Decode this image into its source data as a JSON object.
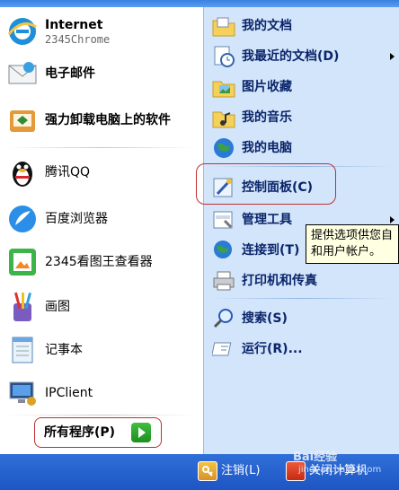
{
  "left": {
    "pinned": [
      {
        "title": "Internet",
        "subtitle": "2345Chrome",
        "icon": "internet-explorer-icon"
      },
      {
        "title": "电子邮件",
        "icon": "email-icon"
      },
      {
        "title": "强力卸载电脑上的软件",
        "icon": "uninstall-icon"
      }
    ],
    "recent": [
      {
        "title": "腾讯QQ",
        "icon": "qq-penguin-icon"
      },
      {
        "title": "百度浏览器",
        "icon": "baidu-browser-icon"
      },
      {
        "title": "2345看图王查看器",
        "icon": "image-viewer-icon"
      },
      {
        "title": "画图",
        "icon": "paint-icon"
      },
      {
        "title": "记事本",
        "icon": "notepad-icon"
      },
      {
        "title": "IPClient",
        "icon": "ipclient-icon"
      }
    ],
    "all_programs": "所有程序(P)"
  },
  "right": {
    "items": [
      {
        "label": "我的文档",
        "icon": "documents-folder-icon"
      },
      {
        "label": "我最近的文档(D)",
        "icon": "recent-documents-icon",
        "submenu": true
      },
      {
        "label": "图片收藏",
        "icon": "pictures-folder-icon"
      },
      {
        "label": "我的音乐",
        "icon": "music-folder-icon"
      },
      {
        "label": "我的电脑",
        "icon": "my-computer-icon"
      },
      {
        "label": "控制面板(C)",
        "icon": "control-panel-icon"
      },
      {
        "label": "管理工具",
        "icon": "admin-tools-icon",
        "submenu": true
      },
      {
        "label": "连接到(T)",
        "icon": "connect-to-icon"
      },
      {
        "label": "打印机和传真",
        "icon": "printer-icon"
      },
      {
        "label": "搜索(S)",
        "icon": "search-icon"
      },
      {
        "label": "运行(R)...",
        "icon": "run-icon"
      }
    ]
  },
  "tooltip": "提供选项供您自和用户帐户。",
  "bottom": {
    "logoff": "注销(L)",
    "shutdown": "关闭计算机"
  },
  "watermark": {
    "text": "Bai经验",
    "url": "jingyan.baidu.com"
  },
  "colors": {
    "taskbar": "#2f6fd8",
    "right_pane": "#d3e5fa",
    "highlight": "#c03030"
  }
}
